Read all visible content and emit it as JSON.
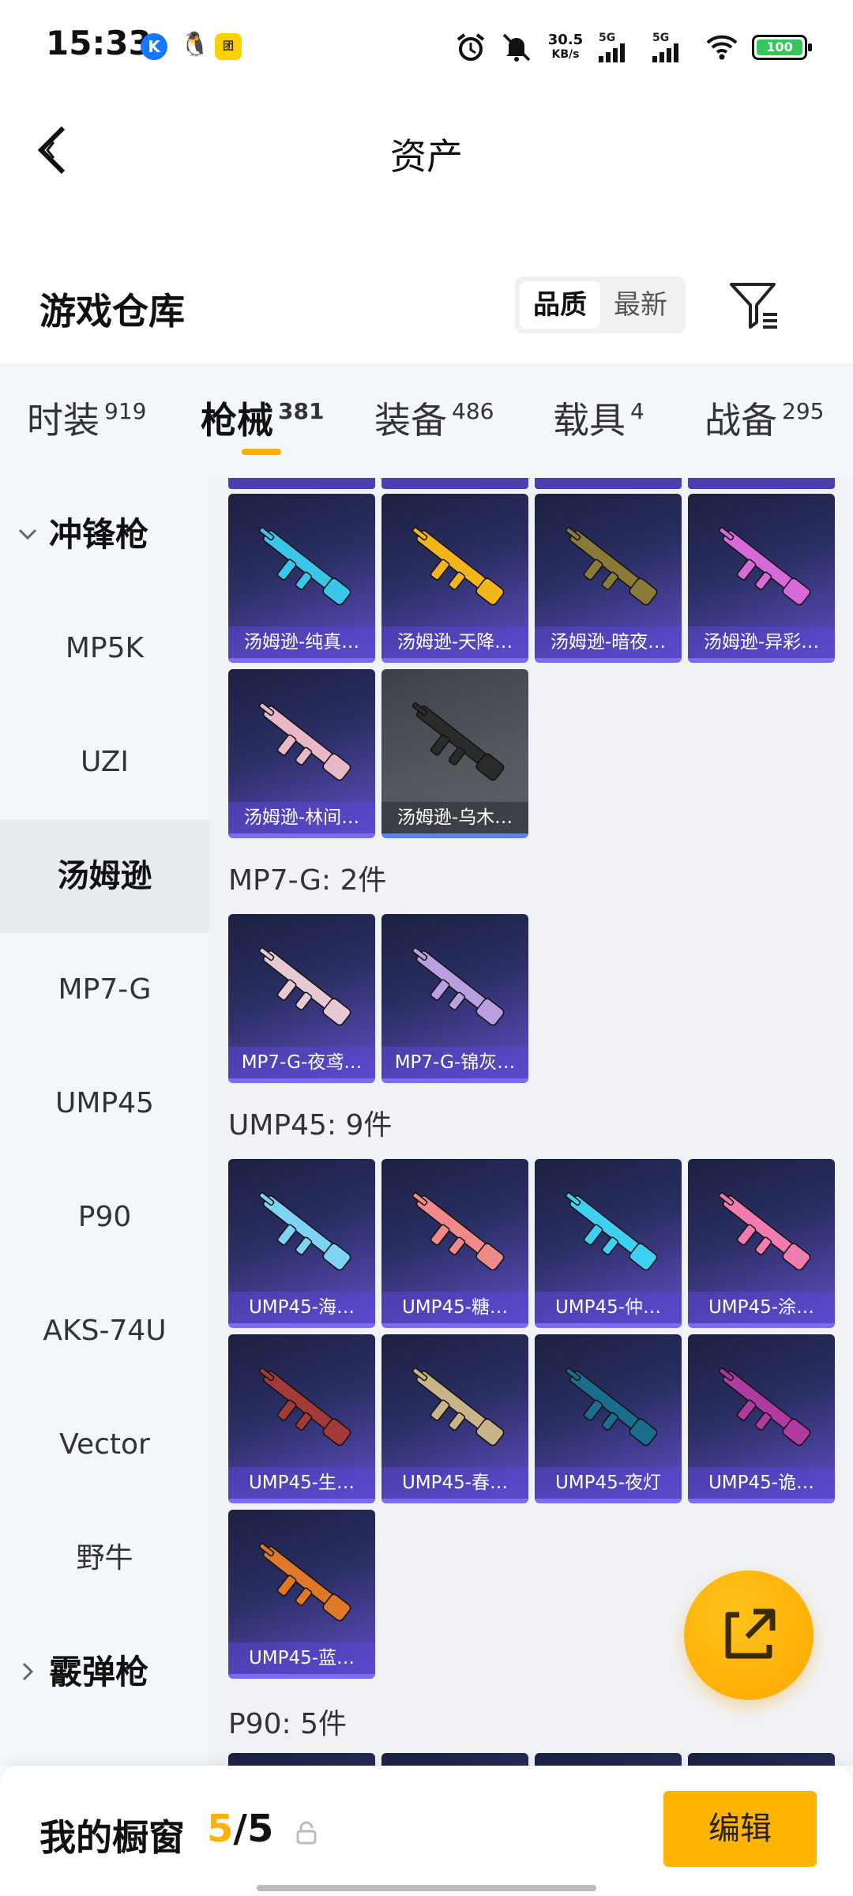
{
  "status_bar": {
    "time": "15:33",
    "net_speed_top": "30.5",
    "net_speed_unit": "KB/s",
    "sim1": "5G",
    "sim2": "5G",
    "battery": "100"
  },
  "header": {
    "title": "资产"
  },
  "warehouse": {
    "title": "游戏仓库",
    "sort_options": [
      "品质",
      "最新"
    ],
    "active_sort": "品质"
  },
  "tabs": [
    {
      "label": "时装",
      "count": "919"
    },
    {
      "label": "枪械",
      "count": "381",
      "active": true
    },
    {
      "label": "装备",
      "count": "486"
    },
    {
      "label": "载具",
      "count": "4"
    },
    {
      "label": "战备",
      "count": "295"
    }
  ],
  "sidenav": [
    {
      "label": "冲锋枪",
      "type": "group-expanded"
    },
    {
      "label": "MP5K"
    },
    {
      "label": "UZI"
    },
    {
      "label": "汤姆逊",
      "active": true
    },
    {
      "label": "MP7-G"
    },
    {
      "label": "UMP45"
    },
    {
      "label": "P90"
    },
    {
      "label": "AKS-74U"
    },
    {
      "label": "Vector"
    },
    {
      "label": "野牛"
    },
    {
      "label": "霰弹枪",
      "type": "group-collapsed"
    }
  ],
  "groups": {
    "thompson": {
      "items": [
        "汤姆逊-纯真…",
        "汤姆逊-天降…",
        "汤姆逊-暗夜…",
        "汤姆逊-异彩…",
        "汤姆逊-林间…",
        "汤姆逊-乌木…"
      ]
    },
    "mp7g": {
      "label": "MP7-G: 2件",
      "items": [
        "MP7-G-夜鸢…",
        "MP7-G-锦灰…"
      ]
    },
    "ump45": {
      "label": "UMP45: 9件",
      "items": [
        "UMP45-海…",
        "UMP45-糖…",
        "UMP45-仲…",
        "UMP45-涂…",
        "UMP45-生…",
        "UMP45-春…",
        "UMP45-夜灯",
        "UMP45-诡…",
        "UMP45-蓝…"
      ]
    },
    "p90": {
      "label": "P90: 5件"
    }
  },
  "gun_colors": {
    "thompson": [
      "#39c6e8",
      "#f2b51c",
      "#8a7a3a",
      "#d76ad8",
      "#e8b8c8",
      "#2b2b2b"
    ],
    "mp7g": [
      "#e7c9d6",
      "#b8a0e0"
    ],
    "ump45": [
      "#7fd3f2",
      "#f08a8a",
      "#3fd0f0",
      "#f07cb0",
      "#a33a3a",
      "#c9b48a",
      "#1b6d8e",
      "#b03aa0",
      "#e0782a"
    ]
  },
  "bottom_bar": {
    "label": "我的橱窗",
    "count_current": "5",
    "count_sep": "/",
    "count_total": "5",
    "edit_label": "编辑"
  },
  "colors": {
    "accent": "#ffb000",
    "card_purple": "#5f4fc6"
  }
}
